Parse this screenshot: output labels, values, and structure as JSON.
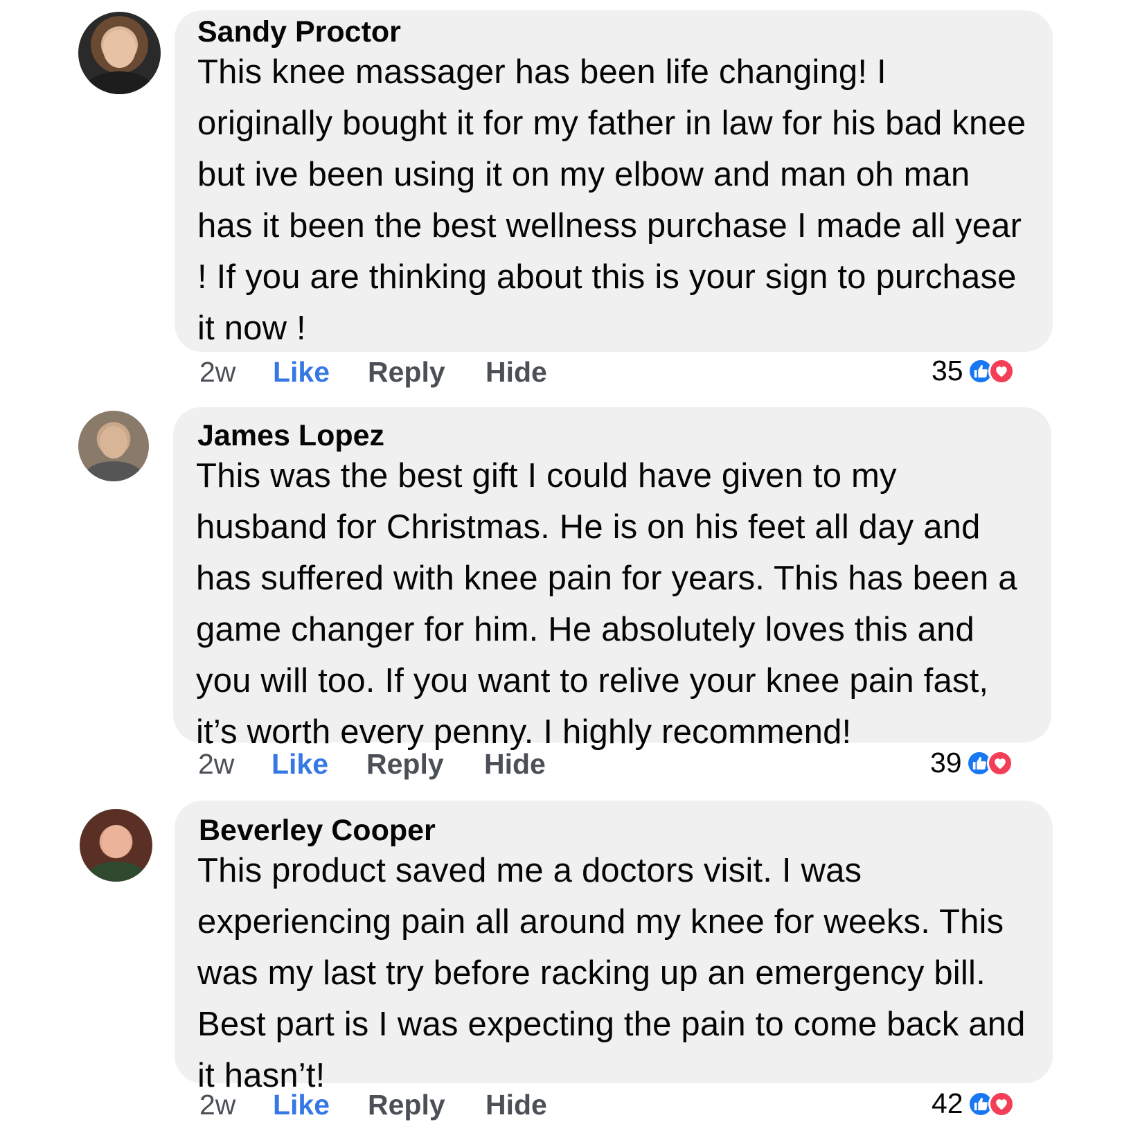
{
  "comments": [
    {
      "author": "Sandy Proctor",
      "text": "This knee massager has been life changing! I originally bought it for my father in law for his bad knee but ive been using it on my elbow and man oh man has it been the best wellness purchase I made all year ! If you are thinking about this is your sign to purchase it now !",
      "time": "2w",
      "like_label": "Like",
      "reply_label": "Reply",
      "hide_label": "Hide",
      "reaction_count": "35"
    },
    {
      "author": "James Lopez",
      "text": "This was the best gift I could have given to my husband for Christmas. He is on his feet all day and has suffered with knee pain for years. This has been a game changer for him. He absolutely loves this and you will too. If you want to relive your knee pain fast, it’s worth every penny. I highly recommend!",
      "time": "2w",
      "like_label": "Like",
      "reply_label": "Reply",
      "hide_label": "Hide",
      "reaction_count": "39"
    },
    {
      "author": "Beverley Cooper",
      "text": "This product saved me a doctors visit. I was experiencing pain all around my knee for weeks. This was my last try before racking up an emergency bill. Best part is I was expecting the pain to come back and it hasn’t!",
      "time": "2w",
      "like_label": "Like",
      "reply_label": "Reply",
      "hide_label": "Hide",
      "reaction_count": "42"
    }
  ],
  "icons": {
    "like": "thumbs-up-icon",
    "love": "heart-icon"
  },
  "colors": {
    "link": "#3578e5",
    "bubble": "#f0f0f0",
    "like_reaction": "#1877f2",
    "love_reaction": "#f33e58"
  }
}
